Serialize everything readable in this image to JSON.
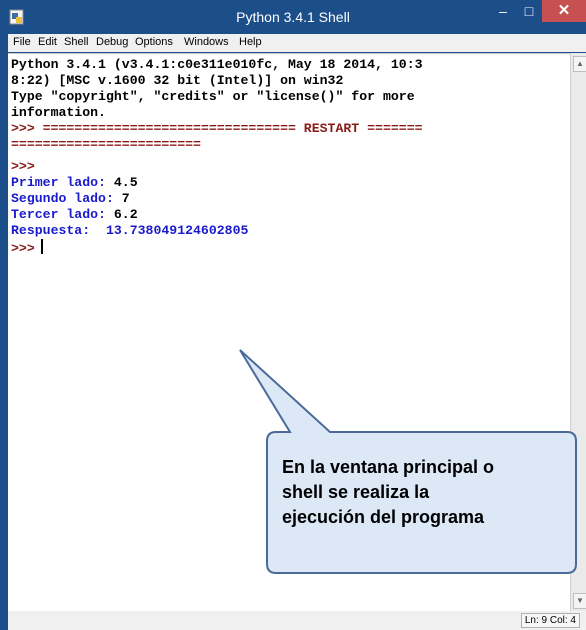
{
  "window": {
    "title": "Python 3.4.1 Shell",
    "minimize_glyph": "–",
    "maximize_glyph": "□",
    "close_glyph": "✕"
  },
  "menubar": {
    "items": [
      "File",
      "Edit",
      "Shell",
      "Debug",
      "Options",
      "Windows",
      "Help"
    ]
  },
  "shell": {
    "lines": [
      {
        "text": "Python 3.4.1 (v3.4.1:c0e311e010fc, May 18 2014, 10:3",
        "style": "black"
      },
      {
        "text": "8:22) [MSC v.1600 32 bit (Intel)] on win32",
        "style": "black"
      },
      {
        "text": "Type \"copyright\", \"credits\" or \"license()\" for more",
        "style": "black"
      },
      {
        "text": "information.",
        "style": "black"
      },
      {
        "text": ">>> ================================ RESTART =======",
        "style": "restart"
      },
      {
        "text": "========================",
        "style": "prompt"
      },
      {
        "text": ">>>",
        "style": "prompt"
      },
      {
        "text": "Primer lado: 4.5",
        "style": "io",
        "label": "Primer lado:",
        "value": " 4.5"
      },
      {
        "text": "Segundo lado: 7",
        "style": "io",
        "label": "Segundo lado:",
        "value": " 7"
      },
      {
        "text": "Tercer lado: 6.2",
        "style": "io",
        "label": "Tercer lado:",
        "value": " 6.2"
      },
      {
        "text": "Respuesta:  13.738049124602805",
        "style": "blue"
      },
      {
        "text": ">>>",
        "style": "prompt-cursor"
      }
    ]
  },
  "statusbar": {
    "text": "Ln: 9 Col: 4"
  },
  "callout": {
    "lines": [
      "En la ventana principal o",
      "shell se realiza la",
      "ejecución del programa"
    ]
  },
  "colors": {
    "titlebar": "#1c4e8a",
    "prompt": "#8a1a1a",
    "output_blue": "#1a1acc",
    "callout_fill": "#dde8f7",
    "callout_stroke": "#4a6b99"
  }
}
